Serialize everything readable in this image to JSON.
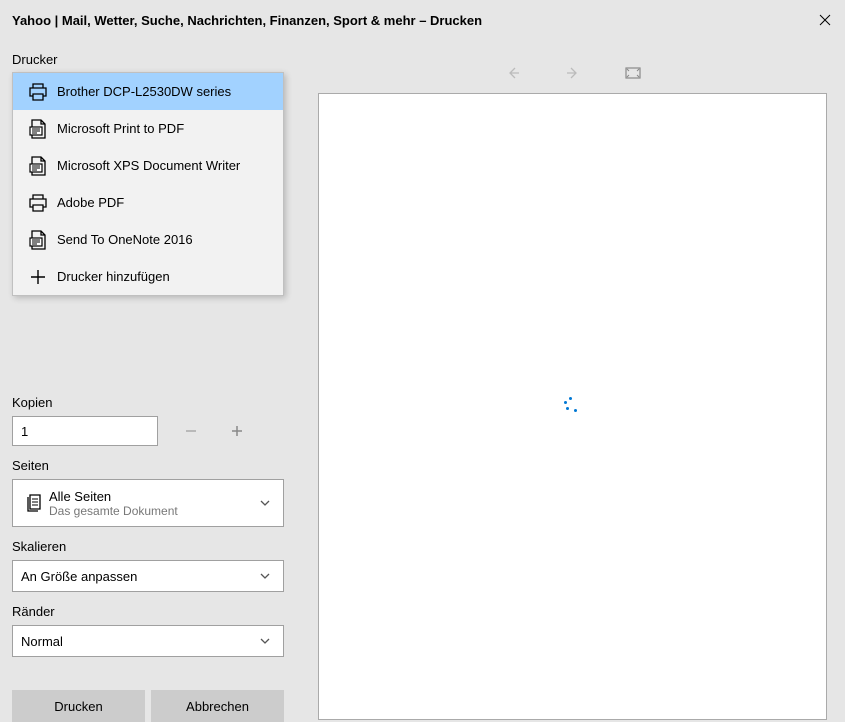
{
  "title": "Yahoo | Mail, Wetter, Suche, Nachrichten, Finanzen, Sport & mehr – Drucken",
  "labels": {
    "printer": "Drucker",
    "copies": "Kopien",
    "pages": "Seiten",
    "scaling": "Skalieren",
    "margins": "Ränder"
  },
  "printers": [
    {
      "name": "Brother DCP-L2530DW series",
      "icon": "printer"
    },
    {
      "name": "Microsoft Print to PDF",
      "icon": "pdf"
    },
    {
      "name": "Microsoft XPS Document Writer",
      "icon": "pdf"
    },
    {
      "name": "Adobe PDF",
      "icon": "printer"
    },
    {
      "name": "Send To OneNote 2016",
      "icon": "pdf"
    },
    {
      "name": "Drucker hinzufügen",
      "icon": "add"
    }
  ],
  "selected_printer_index": 0,
  "copies": {
    "value": "1"
  },
  "pages": {
    "main": "Alle Seiten",
    "sub": "Das gesamte Dokument"
  },
  "scaling": {
    "value": "An Größe anpassen"
  },
  "margins": {
    "value": "Normal"
  },
  "buttons": {
    "print": "Drucken",
    "cancel": "Abbrechen"
  }
}
